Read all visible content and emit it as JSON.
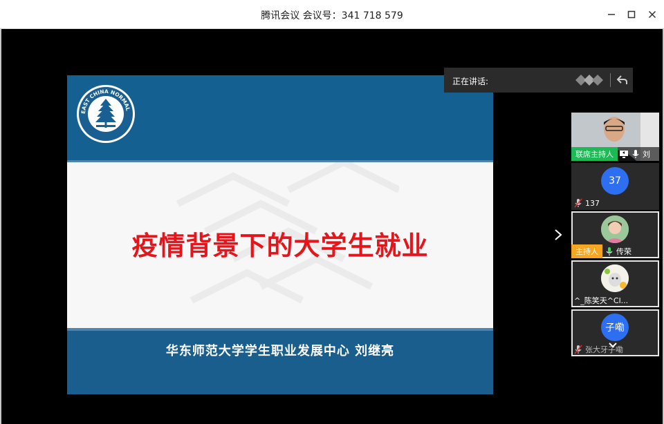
{
  "window": {
    "title": "腾讯会议 会议号：341 718 579"
  },
  "slide": {
    "title": "疫情背景下的大学生就业",
    "subtitle": "华东师范大学学生职业发展中心  刘继亮",
    "logo_text": "EAST CHINA NORMAL UNIVERSITY"
  },
  "speaking": {
    "label": "正在讲话:"
  },
  "participants": [
    {
      "tag": "联席主持人",
      "name": "刘",
      "type": "video"
    },
    {
      "avatar": "37",
      "name": "137",
      "type": "circle"
    },
    {
      "tag": "主持人",
      "name": "传荣",
      "type": "photo"
    },
    {
      "name": "^_陈笑天^Cl...",
      "type": "photo2"
    },
    {
      "avatar": "子嘞",
      "name": "张大牙子嘞",
      "type": "circle"
    }
  ],
  "colors": {
    "cohost_tag": "#1db954",
    "host_tag": "#f5a623",
    "avatar_blue": "#2d6ff0",
    "slide_title_red": "#e4161c",
    "slide_blue": "#146191"
  }
}
